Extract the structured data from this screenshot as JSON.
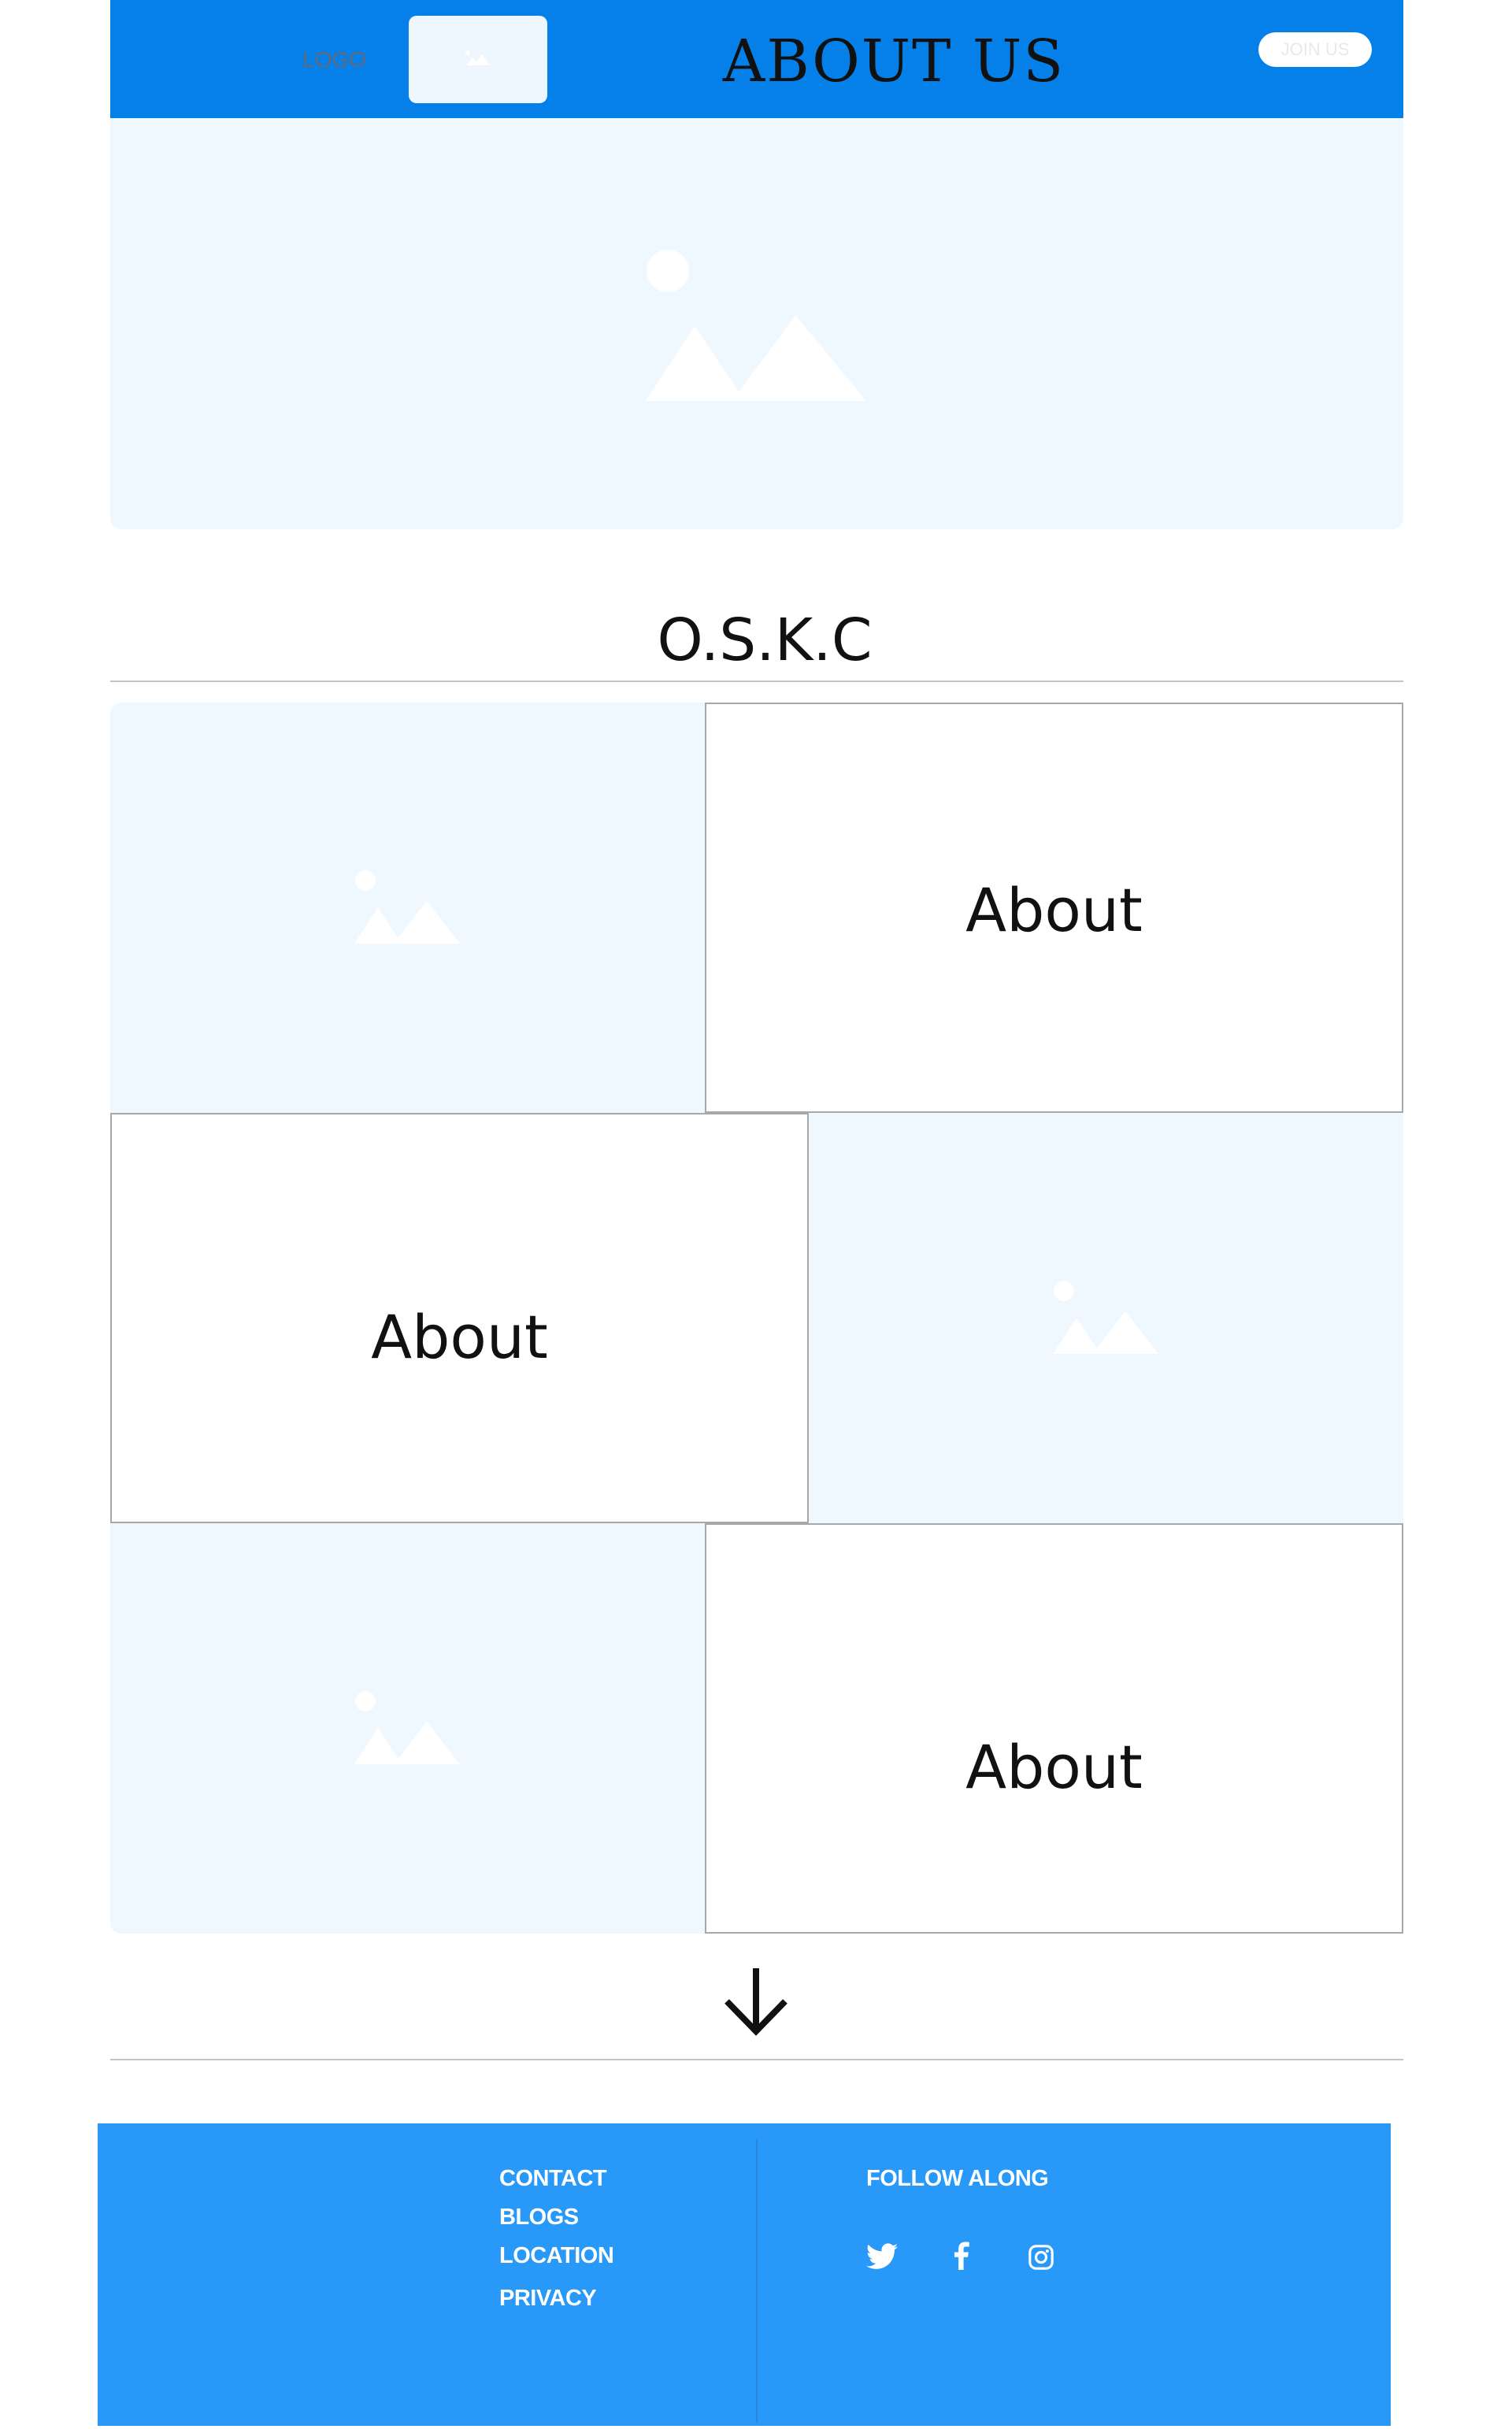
{
  "header": {
    "logo_text": "LOGO",
    "title": "ABOUT US",
    "join_label": "JOIN US"
  },
  "section": {
    "brand": "O.S.K.C"
  },
  "grid": {
    "about_labels": [
      "About",
      "About",
      "About"
    ]
  },
  "footer": {
    "links": [
      "CONTACT",
      "BLOGS",
      "LOCATION",
      "PRIVACY"
    ],
    "follow_heading": "FOLLOW ALONG",
    "social_icons": [
      "twitter-icon",
      "facebook-icon",
      "instagram-icon"
    ]
  },
  "colors": {
    "header_bg": "#0580e8",
    "footer_bg": "#2899f9",
    "placeholder_bg": "#eff7ff",
    "border": "#a8a8a8"
  }
}
